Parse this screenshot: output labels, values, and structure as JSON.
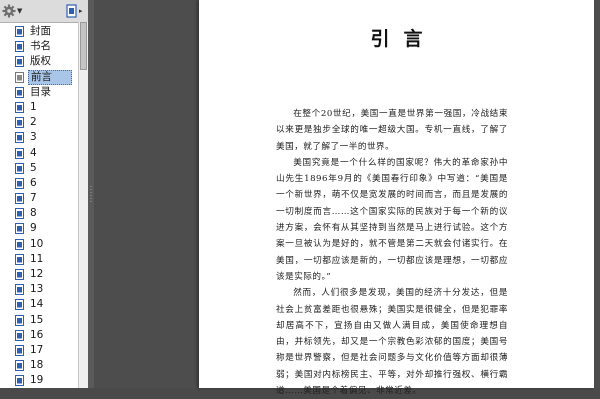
{
  "sidebar": {
    "toolbar": {
      "options_icon": "gear-icon",
      "view_icon": "document-icon"
    },
    "bookmarks": [
      {
        "label": "封面",
        "icon": "page-icon"
      },
      {
        "label": "书名",
        "icon": "page-icon"
      },
      {
        "label": "版权",
        "icon": "page-icon"
      },
      {
        "label": "前言",
        "icon": "page-icon",
        "selected": true
      },
      {
        "label": "目录",
        "icon": "page-icon"
      },
      {
        "label": "1",
        "icon": "page-icon"
      },
      {
        "label": "2",
        "icon": "page-icon"
      },
      {
        "label": "3",
        "icon": "page-icon"
      },
      {
        "label": "4",
        "icon": "page-icon"
      },
      {
        "label": "5",
        "icon": "page-icon"
      },
      {
        "label": "6",
        "icon": "page-icon"
      },
      {
        "label": "7",
        "icon": "page-icon"
      },
      {
        "label": "8",
        "icon": "page-icon"
      },
      {
        "label": "9",
        "icon": "page-icon"
      },
      {
        "label": "10",
        "icon": "page-icon"
      },
      {
        "label": "11",
        "icon": "page-icon"
      },
      {
        "label": "12",
        "icon": "page-icon"
      },
      {
        "label": "13",
        "icon": "page-icon"
      },
      {
        "label": "14",
        "icon": "page-icon"
      },
      {
        "label": "15",
        "icon": "page-icon"
      },
      {
        "label": "16",
        "icon": "page-icon"
      },
      {
        "label": "17",
        "icon": "page-icon"
      },
      {
        "label": "18",
        "icon": "page-icon"
      },
      {
        "label": "19",
        "icon": "page-icon"
      }
    ]
  },
  "document": {
    "title": "引言",
    "paragraphs": [
      "在整个20世纪，美国一直是世界第一强国，冷战结束以来更是独步全球的唯一超级大国。专机一直线，了解了美国，就了解了一半的世界。",
      "美国究竟是一个什么样的国家呢？伟大的革命家孙中山先生1896年9月的《美国春行印象》中写道：“美国是一个新世界，萌不仅是宽发展的时间而言，而且是发展的一切制度而言……这个国家实际的民族对于每一个新的议进方案，会怀有从其坚持到当然是马上进行试验。这个方案一旦被认为是好的，就不管是第二天就会付诸实行。在美国，一切都应该是新的，一切都应该是理想，一切都应该是实际的。”",
      "然而，人们很多是发现，美国的经济十分发达，但是社会上贫富差距也很悬殊；美国实是很健全，但是犯罪率却居高不下，宣扬自由又做人满目成，美国使命理想自由，并标领先，却又是一个宗教色彩浓郁的国度；美国号称是世界警察，但是社会问题多与文化价值等方面却很薄弱；美国对内标榜民主、平等，对外却推行强权、横行霸道……美国是个着偏见、非常近差。"
    ]
  },
  "colors": {
    "sidebar_bg": "#ffffff",
    "selection": "#a9c6e8",
    "canvas_bg": "#4d4d4d",
    "page_bg": "#ffffff",
    "icon_blue": "#2f5fb3"
  }
}
